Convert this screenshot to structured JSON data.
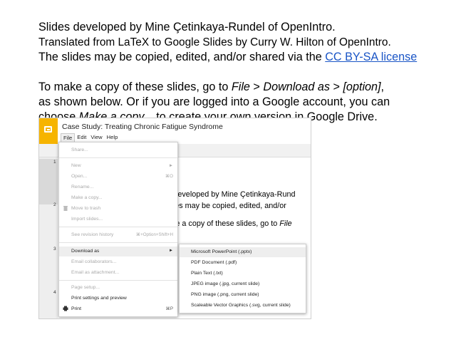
{
  "intro": {
    "line1": "Slides developed by Mine Çetinkaya-Rundel of OpenIntro.",
    "line2": "Translated from LaTeX to Google Slides by Curry W. Hilton of OpenIntro.",
    "line3_text": "The slides may be copied, edited, and/or shared via the ",
    "line3_link": "CC BY-SA license",
    "line4_a": "To make a copy of these slides, go to ",
    "line4_file": "File",
    "line4_b": " > ",
    "line4_download": "Download as",
    "line4_c": " > ",
    "line4_option": "[option]",
    "line4_d": ",",
    "line5": "as shown below. Or if you are logged into a Google account, you can",
    "line6_a": "choose ",
    "line6_make": "Make a copy...",
    "line6_b": " to create your own version in Google Drive."
  },
  "screenshot": {
    "doc_title": "Case Study: Treating Chronic Fatigue Syndrome",
    "menubar": [
      "File",
      "Edit",
      "View",
      "Help"
    ],
    "slide_numbers": [
      "1",
      "2",
      "3",
      "4"
    ],
    "canvas_lines": [
      "es developed by Mine Çetinkaya-Rund",
      "slides may be copied, edited, and/or",
      "nake a copy of these slides, go to "
    ],
    "canvas_file_word": "File",
    "file_menu": [
      {
        "label": "Share...",
        "shortcut": "",
        "enabled": false
      },
      {
        "label": "New",
        "shortcut": "►",
        "enabled": false
      },
      {
        "label": "Open...",
        "shortcut": "⌘O",
        "enabled": false
      },
      {
        "label": "Rename...",
        "shortcut": "",
        "enabled": false
      },
      {
        "label": "Make a copy...",
        "shortcut": "",
        "enabled": false
      },
      {
        "label": "Move to trash",
        "shortcut": "",
        "enabled": false
      },
      {
        "label": "Import slides...",
        "shortcut": "",
        "enabled": false
      },
      {
        "label": "See revision history",
        "shortcut": "⌘+Option+Shift+H",
        "enabled": false
      },
      {
        "label": "Download as",
        "shortcut": "►",
        "enabled": true
      },
      {
        "label": "Email collaborators...",
        "shortcut": "",
        "enabled": false
      },
      {
        "label": "Email as attachment...",
        "shortcut": "",
        "enabled": false
      },
      {
        "label": "Page setup...",
        "shortcut": "",
        "enabled": false
      },
      {
        "label": "Print settings and preview",
        "shortcut": "",
        "enabled": true
      },
      {
        "label": "Print",
        "shortcut": "⌘P",
        "enabled": true
      }
    ],
    "download_submenu": [
      "Microsoft PowerPoint (.pptx)",
      "PDF Document (.pdf)",
      "Plain Text (.txt)",
      "JPEG image (.jpg, current slide)",
      "PNG image (.png, current slide)",
      "Scaleable Vector Graphics (.svg, current slide)"
    ],
    "icons": {
      "logo": "google-slides-logo",
      "trash": "trash-icon",
      "print": "printer-icon"
    },
    "colors": {
      "logo": "#f6b400",
      "link": "#1a55c6"
    }
  }
}
